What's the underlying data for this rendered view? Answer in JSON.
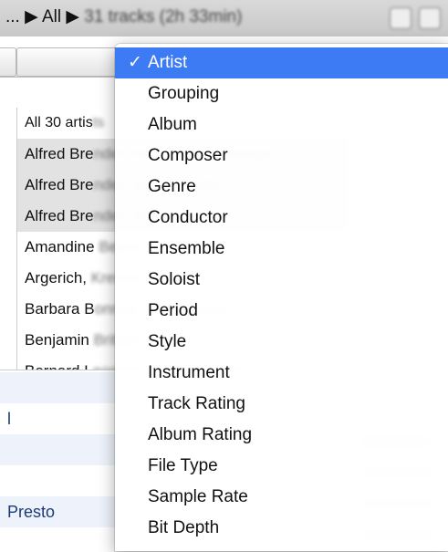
{
  "toolbar": {
    "breadcrumb_prefix": "... ▶ All ▶",
    "breadcrumb_blurred": "31 tracks (2h 33min)"
  },
  "browser": {
    "artists": [
      {
        "visible": "All 30 artis",
        "hidden": "ts",
        "selected": false
      },
      {
        "visible": "Alfred Bre",
        "hidden": "ndel, Hugo Reichenberger",
        "selected": true
      },
      {
        "visible": "Alfred Bre",
        "hidden": "ndel, Simon Rattle",
        "selected": true
      },
      {
        "visible": "Alfred Bre",
        "hidden": "ndel, Simon Rattle,",
        "selected": true
      },
      {
        "visible": "Amandine",
        "hidden": " Beyer, Gli Incogniti",
        "selected": false
      },
      {
        "visible": "Argerich,",
        "hidden": " Kremer, Maisky",
        "selected": false
      },
      {
        "visible": "Barbara B",
        "hidden": "onney, Peter Pears",
        "selected": false
      },
      {
        "visible": "Benjamin",
        "hidden": " Britten, Peter",
        "selected": false
      },
      {
        "visible": "Bernard L",
        "hidden": "eonard, Various Artist",
        "selected": false
      }
    ]
  },
  "tracks": {
    "rows": [
      {
        "text": "l"
      },
      {
        "text": ""
      },
      {
        "text": ""
      },
      {
        "text": "Presto"
      }
    ]
  },
  "menu": {
    "items": [
      {
        "label": "Artist",
        "checked": true
      },
      {
        "label": "Grouping",
        "checked": false
      },
      {
        "label": "Album",
        "checked": false
      },
      {
        "label": "Composer",
        "checked": false
      },
      {
        "label": "Genre",
        "checked": false
      },
      {
        "label": "Conductor",
        "checked": false
      },
      {
        "label": "Ensemble",
        "checked": false
      },
      {
        "label": "Soloist",
        "checked": false
      },
      {
        "label": "Period",
        "checked": false
      },
      {
        "label": "Style",
        "checked": false
      },
      {
        "label": "Instrument",
        "checked": false
      },
      {
        "label": "Track Rating",
        "checked": false
      },
      {
        "label": "Album Rating",
        "checked": false
      },
      {
        "label": "File Type",
        "checked": false
      },
      {
        "label": "Sample Rate",
        "checked": false
      },
      {
        "label": "Bit Depth",
        "checked": false
      }
    ],
    "check_glyph": "✓",
    "highlight_color": "#3d7bf5"
  }
}
